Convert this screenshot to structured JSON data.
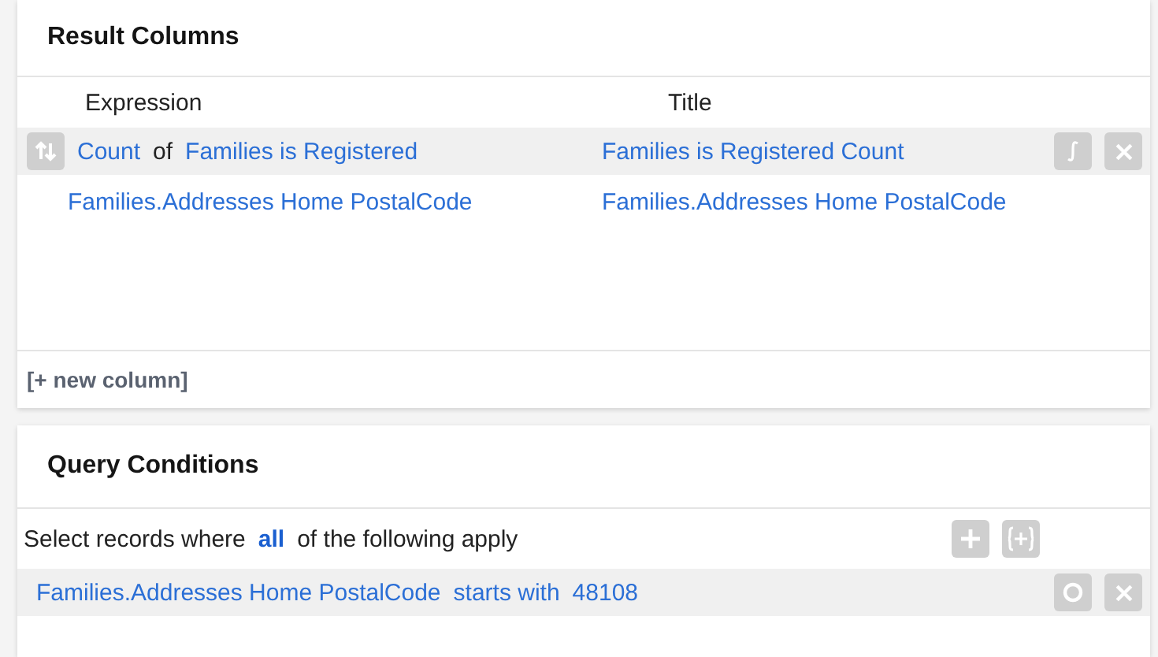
{
  "result_columns": {
    "title": "Result Columns",
    "headers": [
      "Expression",
      "Title"
    ],
    "rows": [
      {
        "kind": "aggregate",
        "function": "Count",
        "joiner": "of",
        "expression": "Families is Registered",
        "title": "Families is Registered Count",
        "highlighted": true
      },
      {
        "kind": "plain",
        "expression": "Families.Addresses Home PostalCode",
        "title": "Families.Addresses Home PostalCode",
        "highlighted": false
      }
    ],
    "add_link": "[+ new column]"
  },
  "query_conditions": {
    "title": "Query Conditions",
    "intro_before": "Select records where",
    "mode": "all",
    "intro_after": "of the following apply",
    "conditions": [
      {
        "field": "Families.Addresses Home PostalCode",
        "operator": "starts with",
        "value": "48108",
        "highlighted": true
      }
    ]
  }
}
